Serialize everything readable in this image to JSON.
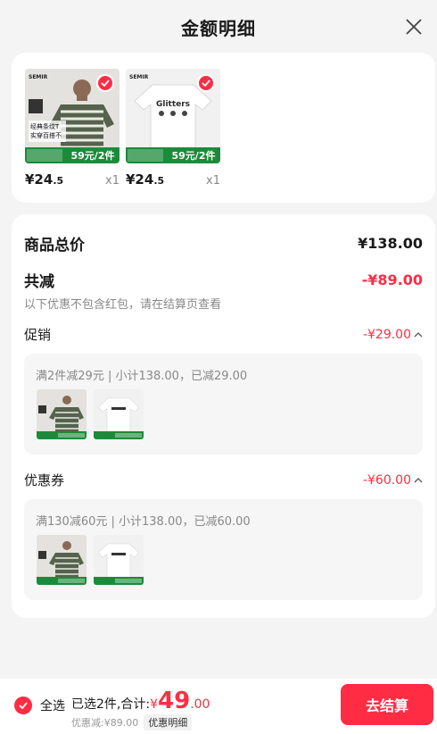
{
  "header": {
    "title": "金额明细"
  },
  "products": [
    {
      "price": "¥24",
      "price_dec": ".5",
      "qty": "x1",
      "badge": "59元/2件",
      "brand": "SEMIR",
      "caption1": "经典条纹T",
      "caption2": "实穿百搭不"
    },
    {
      "price": "¥24",
      "price_dec": ".5",
      "qty": "x1",
      "badge": "59元/2件",
      "brand": "SEMIR",
      "shirt_text": "Glitters"
    }
  ],
  "summary": {
    "total_label": "商品总价",
    "total_value": "¥138.00",
    "discount_label": "共减",
    "discount_value": "-¥89.00",
    "note": "以下优惠不包含红包，请在结算页查看"
  },
  "promotion": {
    "label": "促销",
    "value": "-¥29.00",
    "detail": "满2件减29元 | 小计138.00，已减29.00"
  },
  "coupon": {
    "label": "优惠券",
    "value": "-¥60.00",
    "detail": "满130减60元 | 小计138.00，已减60.00"
  },
  "bottom": {
    "select_all": "全选",
    "selected_text": "已选2件,合计:",
    "total_prefix": "¥",
    "total_int": "49",
    "total_dec": ".00",
    "savings": "优惠减:¥89.00",
    "detail_link": "优惠明细",
    "checkout": "去结算"
  },
  "colors": {
    "accent": "#ff2c44",
    "green": "#1d8a3a"
  }
}
